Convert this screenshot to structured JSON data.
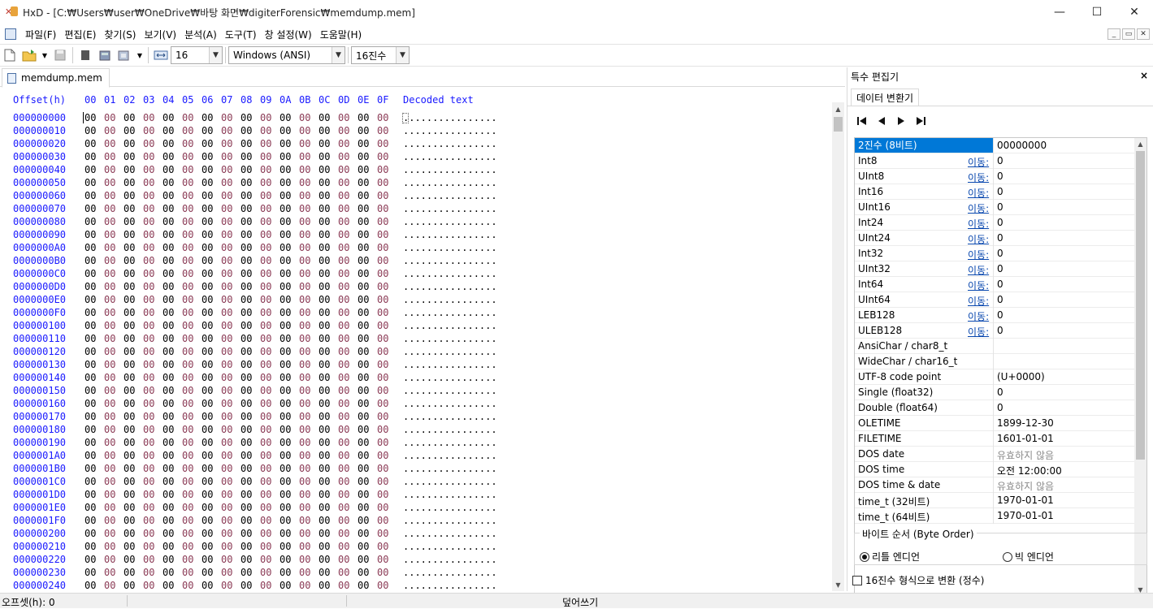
{
  "window": {
    "title": "HxD - [C:₩Users₩user₩OneDrive₩바탕 화면₩digiterForensic₩memdump.mem]",
    "minimize": "—",
    "maximize": "☐",
    "close": "✕"
  },
  "menu": {
    "items": [
      "파일(F)",
      "편집(E)",
      "찾기(S)",
      "보기(V)",
      "분석(A)",
      "도구(T)",
      "창 설정(W)",
      "도움말(H)"
    ],
    "mdi_minimize": "_",
    "mdi_restore": "▭",
    "mdi_close": "✕"
  },
  "toolbar": {
    "bytes_per_row": "16",
    "charset": "Windows (ANSI)",
    "offset_base": "16진수",
    "icons": [
      "new-file-icon",
      "open-file-icon",
      "dropdown-icon",
      "save-icon",
      "close-file-icon",
      "open-disk-icon",
      "open-ram-icon",
      "dropdown-icon",
      "bytes-per-row-icon"
    ]
  },
  "document": {
    "tab_label": "memdump.mem"
  },
  "hex": {
    "header_offset": "Offset(h)",
    "header_bytes": [
      "00",
      "01",
      "02",
      "03",
      "04",
      "05",
      "06",
      "07",
      "08",
      "09",
      "0A",
      "0B",
      "0C",
      "0D",
      "0E",
      "0F"
    ],
    "header_text": "Decoded text",
    "offsets": [
      "000000000",
      "000000010",
      "000000020",
      "000000030",
      "000000040",
      "000000050",
      "000000060",
      "000000070",
      "000000080",
      "000000090",
      "0000000A0",
      "0000000B0",
      "0000000C0",
      "0000000D0",
      "0000000E0",
      "0000000F0",
      "000000100",
      "000000110",
      "000000120",
      "000000130",
      "000000140",
      "000000150",
      "000000160",
      "000000170",
      "000000180",
      "000000190",
      "0000001A0",
      "0000001B0",
      "0000001C0",
      "0000001D0",
      "0000001E0",
      "0000001F0",
      "000000200",
      "000000210",
      "000000220",
      "000000230",
      "000000240"
    ],
    "byte_value": "00",
    "decoded_row": "................"
  },
  "panel": {
    "title": "특수 편집기",
    "close": "×",
    "tab": "데이터 변환기",
    "nav": [
      "⏮",
      "◀",
      "▶",
      "⏭"
    ],
    "rows": [
      {
        "name": "2진수 (8비트)",
        "link": "",
        "value": "00000000",
        "gray": false,
        "selected": true
      },
      {
        "name": "Int8",
        "link": "이동:",
        "value": "0"
      },
      {
        "name": "UInt8",
        "link": "이동:",
        "value": "0"
      },
      {
        "name": "Int16",
        "link": "이동:",
        "value": "0"
      },
      {
        "name": "UInt16",
        "link": "이동:",
        "value": "0"
      },
      {
        "name": "Int24",
        "link": "이동:",
        "value": "0"
      },
      {
        "name": "UInt24",
        "link": "이동:",
        "value": "0"
      },
      {
        "name": "Int32",
        "link": "이동:",
        "value": "0"
      },
      {
        "name": "UInt32",
        "link": "이동:",
        "value": "0"
      },
      {
        "name": "Int64",
        "link": "이동:",
        "value": "0"
      },
      {
        "name": "UInt64",
        "link": "이동:",
        "value": "0"
      },
      {
        "name": "LEB128",
        "link": "이동:",
        "value": "0"
      },
      {
        "name": "ULEB128",
        "link": "이동:",
        "value": "0"
      },
      {
        "name": "AnsiChar / char8_t",
        "link": "",
        "value": ""
      },
      {
        "name": "WideChar / char16_t",
        "link": "",
        "value": ""
      },
      {
        "name": "UTF-8 code point",
        "link": "",
        "value": " (U+0000)"
      },
      {
        "name": "Single (float32)",
        "link": "",
        "value": "0"
      },
      {
        "name": "Double (float64)",
        "link": "",
        "value": "0"
      },
      {
        "name": "OLETIME",
        "link": "",
        "value": "1899-12-30"
      },
      {
        "name": "FILETIME",
        "link": "",
        "value": "1601-01-01"
      },
      {
        "name": "DOS date",
        "link": "",
        "value": "유효하지 않음",
        "gray": true
      },
      {
        "name": "DOS time",
        "link": "",
        "value": "오전 12:00:00"
      },
      {
        "name": "DOS time & date",
        "link": "",
        "value": "유효하지 않음",
        "gray": true
      },
      {
        "name": "time_t (32비트)",
        "link": "",
        "value": "1970-01-01"
      },
      {
        "name": "time_t (64비트)",
        "link": "",
        "value": "1970-01-01"
      }
    ],
    "byte_order_label": "바이트 순서 (Byte Order)",
    "little_endian": "리틀 엔디언",
    "big_endian": "빅 엔디언",
    "little_selected": true,
    "hex_convert_label": "16진수 형식으로 변환 (정수)",
    "hex_convert_checked": false
  },
  "status": {
    "offset": "오프셋(h): 0",
    "mode": "덮어쓰기"
  }
}
